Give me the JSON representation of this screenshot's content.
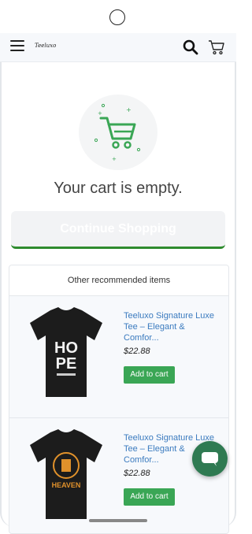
{
  "header": {
    "logo_text": "Teeluxo",
    "menu_icon": "hamburger-icon",
    "search_icon": "search-icon",
    "cart_icon": "cart-icon"
  },
  "cart": {
    "empty_message": "Your cart is empty.",
    "continue_label": "Continue Shopping",
    "illustration_icon": "cart-icon"
  },
  "recommended": {
    "heading": "Other recommended items",
    "items": [
      {
        "title": "Teeluxo Signature Luxe Tee – Elegant & Comfor...",
        "price": "$22.88",
        "button_label": "Add to cart",
        "shirt_text_line1": "HO",
        "shirt_text_line2": "PE"
      },
      {
        "title": "Teeluxo Signature Luxe Tee – Elegant & Comfor...",
        "price": "$22.88",
        "button_label": "Add to cart",
        "shirt_text_line1": "HEAVEN"
      }
    ]
  },
  "chat": {
    "icon": "chat-bubble-icon"
  },
  "colors": {
    "accent_green": "#3aa655",
    "link_blue": "#3b7bbf",
    "chat_green": "#2f7a52",
    "continue_underline": "#2e8b2e"
  }
}
